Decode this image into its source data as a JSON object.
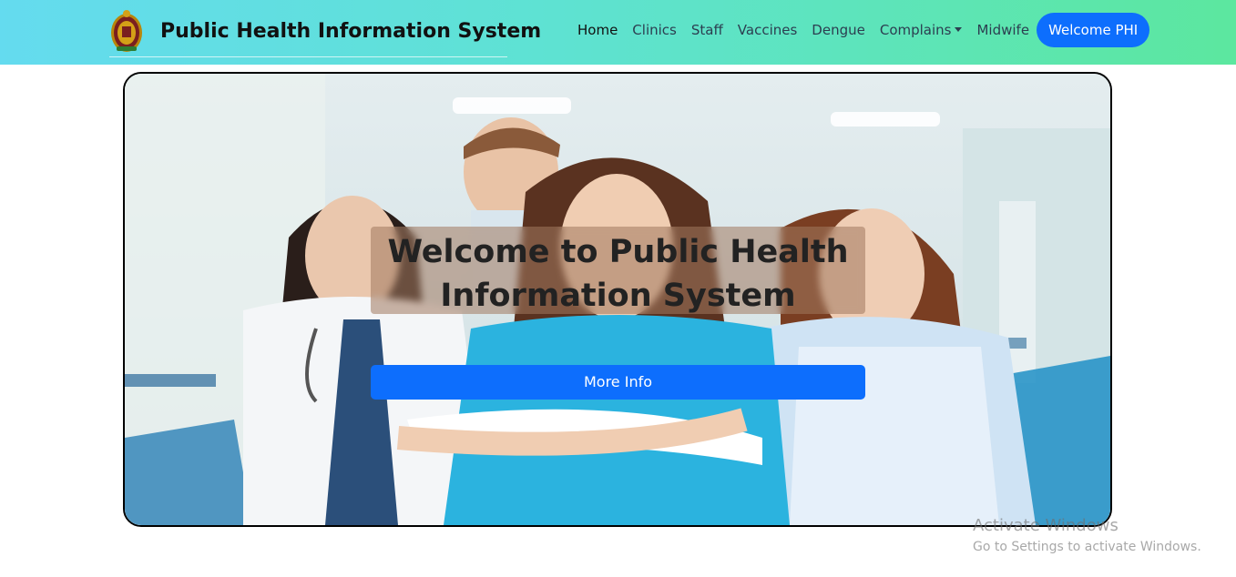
{
  "colors": {
    "navbar_gradient_start": "#64dbef",
    "navbar_gradient_end": "#5ce79f",
    "primary_button": "#0d6efd",
    "hero_border": "#000000"
  },
  "header": {
    "logo_icon": "sri-lanka-emblem-icon",
    "title": "Public Health Information System"
  },
  "nav": {
    "items": [
      {
        "label": "Home",
        "active": true
      },
      {
        "label": "Clinics"
      },
      {
        "label": "Staff"
      },
      {
        "label": "Vaccines"
      },
      {
        "label": "Dengue"
      },
      {
        "label": "Complains",
        "dropdown": true
      },
      {
        "label": "Midwife"
      }
    ],
    "user_button": "Welcome PHI"
  },
  "hero": {
    "heading": "Welcome to Public Health Information System",
    "button_label": "More Info"
  },
  "watermark": {
    "title": "Activate Windows",
    "subtitle": "Go to Settings to activate Windows."
  }
}
